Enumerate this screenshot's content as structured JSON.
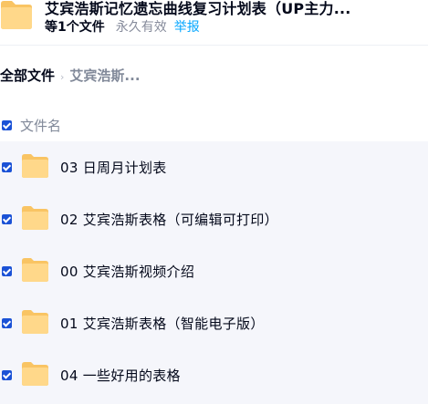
{
  "share": {
    "title": "艾宾浩斯记忆遗忘曲线复习计划表（UP主力...",
    "file_count": "等1个文件",
    "validity": "永久有效",
    "report": "举报"
  },
  "breadcrumb": {
    "root": "全部文件",
    "current": "艾宾浩斯..."
  },
  "list": {
    "column_name": "文件名",
    "files": [
      {
        "name": "03 日周月计划表",
        "icon": "folder-icon",
        "checked": true
      },
      {
        "name": "02 艾宾浩斯表格（可编辑可打印）",
        "icon": "folder-icon",
        "checked": true
      },
      {
        "name": "00 艾宾浩斯视频介绍",
        "icon": "folder-icon",
        "checked": true
      },
      {
        "name": "01 艾宾浩斯表格（智能电子版）",
        "icon": "folder-icon",
        "checked": true
      },
      {
        "name": "04 一些好用的表格",
        "icon": "folder-icon",
        "checked": true
      }
    ]
  },
  "colors": {
    "checkbox": "#1b52d6",
    "folder_back": "#f9c463",
    "folder_front": "#ffd88a",
    "report_link": "#06a7ff",
    "list_background": "#f5f6fb"
  }
}
